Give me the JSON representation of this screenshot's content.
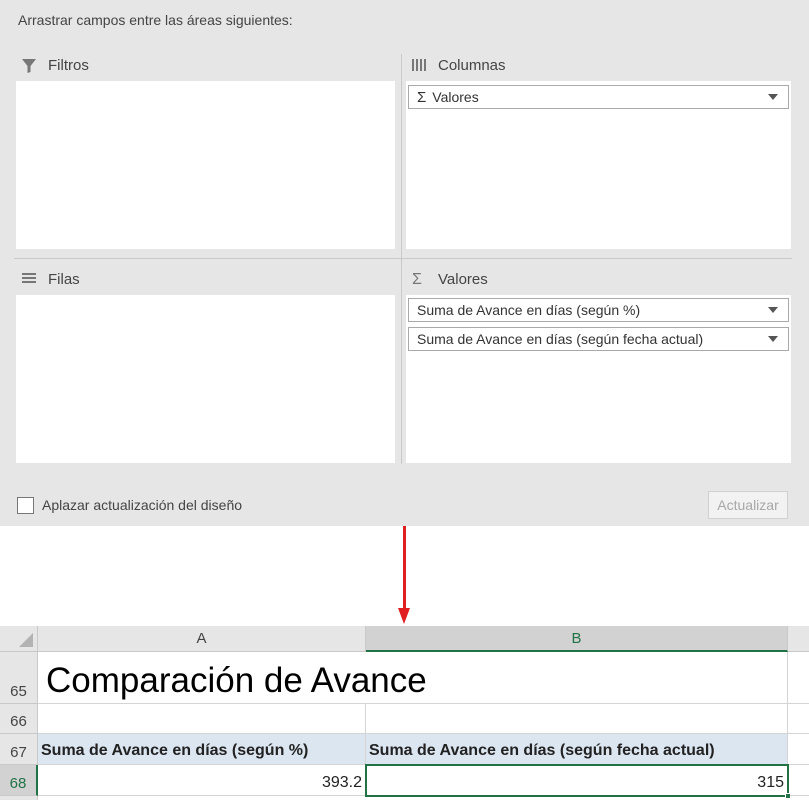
{
  "panel": {
    "instruction": "Arrastrar campos entre las áreas siguientes:",
    "areas": {
      "filters": {
        "label": "Filtros"
      },
      "columns": {
        "label": "Columnas",
        "fields": [
          "Valores"
        ]
      },
      "rows": {
        "label": "Filas"
      },
      "values": {
        "label": "Valores",
        "fields": [
          "Suma de Avance en días (según %)",
          "Suma de Avance en días (según fecha actual)"
        ]
      }
    },
    "defer_label": "Aplazar actualización del diseño",
    "update_label": "Actualizar"
  },
  "sheet": {
    "columns": [
      "A",
      "B"
    ],
    "rows": [
      "65",
      "66",
      "67",
      "68"
    ],
    "title": "Comparación de Avance",
    "headers": [
      "Suma de Avance en días (según %)",
      "Suma de Avance en días (según fecha actual)"
    ],
    "values": [
      "393.2",
      "315"
    ]
  },
  "colors": {
    "accent": "#217346",
    "arrow": "#e02020",
    "header_fill": "#dce6f1"
  }
}
